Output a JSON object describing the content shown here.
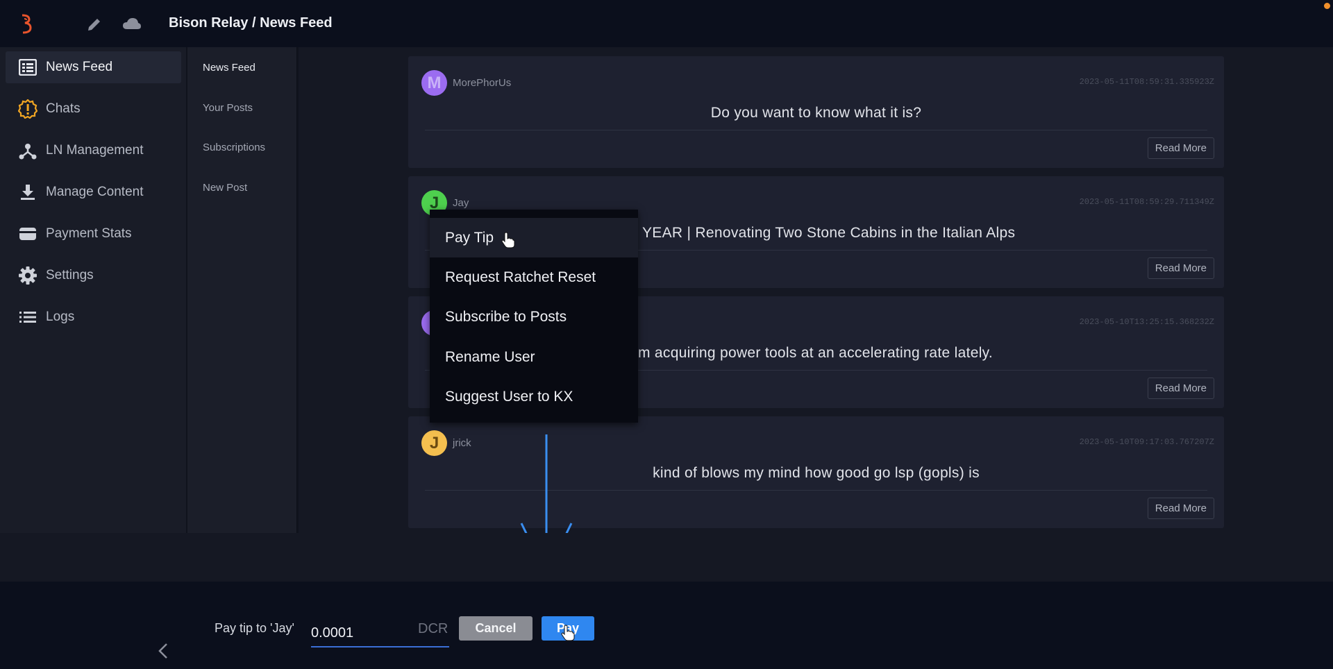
{
  "app": {
    "title": "Bison Relay / News Feed"
  },
  "sidebar": {
    "items": [
      {
        "label": "News Feed",
        "icon": "news-feed-icon"
      },
      {
        "label": "Chats",
        "icon": "chats-alert-icon"
      },
      {
        "label": "LN Management",
        "icon": "ln-management-icon"
      },
      {
        "label": "Manage Content",
        "icon": "download-icon"
      },
      {
        "label": "Payment Stats",
        "icon": "wallet-icon"
      },
      {
        "label": "Settings",
        "icon": "gear-icon"
      },
      {
        "label": "Logs",
        "icon": "list-icon"
      }
    ],
    "active_index": 0
  },
  "subnav": {
    "items": [
      "News Feed",
      "Your Posts",
      "Subscriptions",
      "New Post"
    ]
  },
  "posts": [
    {
      "initial": "M",
      "author": "MorePhorUs",
      "timestamp": "2023-05-11T08:59:31.335923Z",
      "body": "Do you want to know what it is?",
      "action": "Read More",
      "avatar_color": "#9b6cf0"
    },
    {
      "initial": "J",
      "author": "Jay",
      "timestamp": "2023-05-11T08:59:29.711349Z",
      "body": "YEAR | Renovating Two Stone Cabins in the Italian Alps",
      "action": "Read More",
      "avatar_color": "#4ecf4e"
    },
    {
      "initial": "",
      "author": "",
      "timestamp": "2023-05-10T13:25:15.368232Z",
      "body": "m acquiring power tools at an accelerating rate lately.",
      "action": "Read More",
      "avatar_color": "#9b6cf0"
    },
    {
      "initial": "J",
      "author": "jrick",
      "timestamp": "2023-05-10T09:17:03.767207Z",
      "body": "kind of blows my mind how good go lsp (gopls) is",
      "action": "Read More",
      "avatar_color": "#f4bf4f"
    }
  ],
  "context_menu": {
    "items": [
      "Pay Tip",
      "Request Ratchet Reset",
      "Subscribe to Posts",
      "Rename User",
      "Suggest User to KX"
    ]
  },
  "tip_bar": {
    "label": "Pay tip to 'Jay'",
    "amount": "0.0001",
    "unit": "DCR",
    "cancel_label": "Cancel",
    "pay_label": "Pay"
  },
  "colors": {
    "accent": "#2f87f0",
    "logo": "#e8542c",
    "chats_alert": "#f2a623"
  }
}
